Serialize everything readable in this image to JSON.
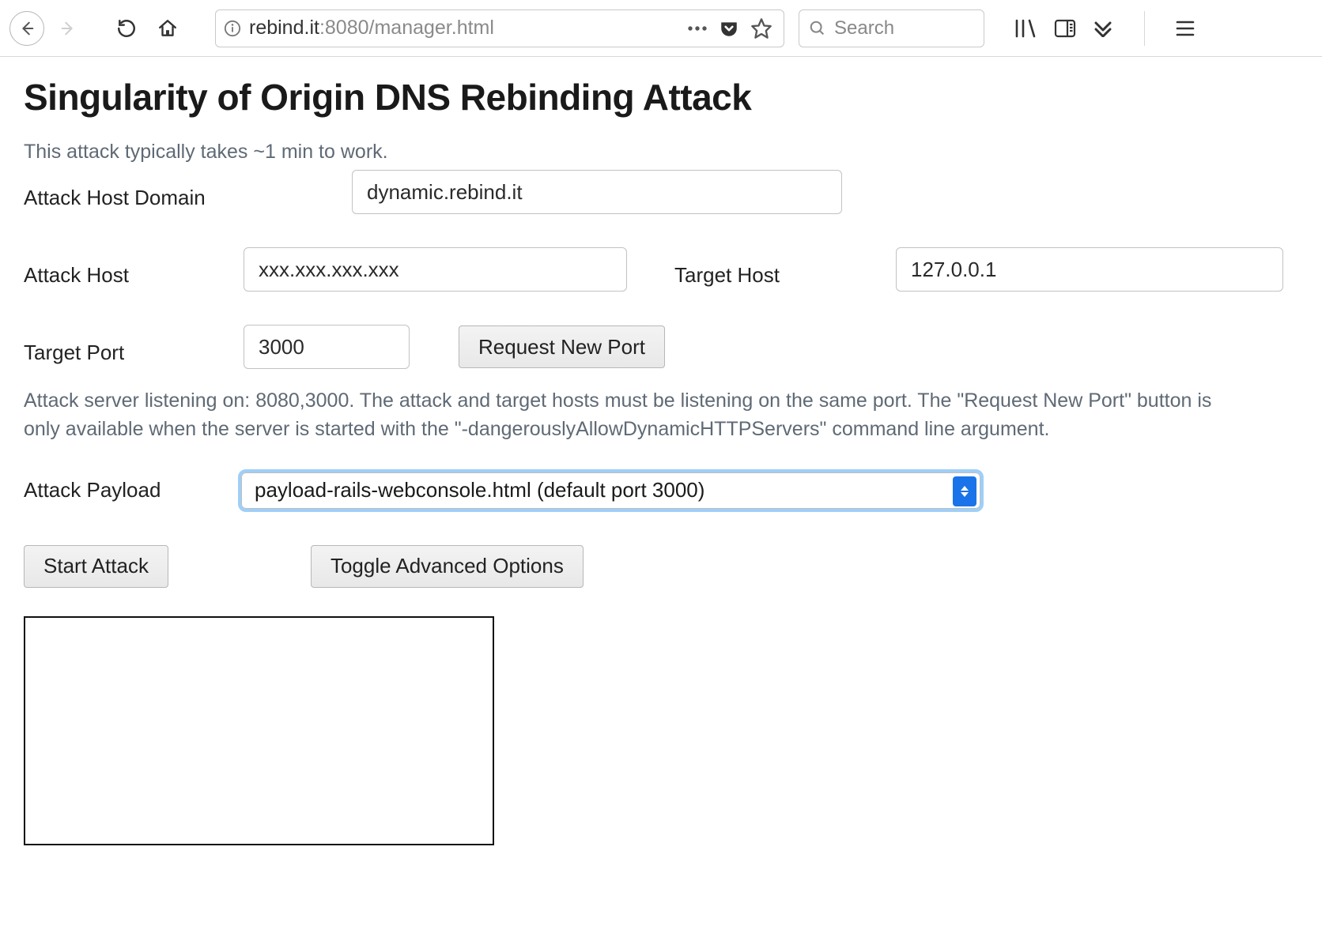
{
  "toolbar": {
    "url_domain": "rebind.it",
    "url_port": ":8080",
    "url_path": "/manager.html",
    "search_placeholder": "Search"
  },
  "page": {
    "title": "Singularity of Origin DNS Rebinding Attack",
    "subtitle": "This attack typically takes ~1 min to work.",
    "labels": {
      "attack_host_domain": "Attack Host Domain",
      "attack_host": "Attack Host",
      "target_host": "Target Host",
      "target_port": "Target Port",
      "attack_payload": "Attack Payload"
    },
    "fields": {
      "attack_host_domain": "dynamic.rebind.it",
      "attack_host": "xxx.xxx.xxx.xxx",
      "target_host": "127.0.0.1",
      "target_port": "3000",
      "attack_payload": "payload-rails-webconsole.html (default port 3000)"
    },
    "buttons": {
      "request_new_port": "Request New Port",
      "start_attack": "Start Attack",
      "toggle_advanced": "Toggle Advanced Options"
    },
    "helptext": "Attack server listening on: 8080,3000. The attack and target hosts must be listening on the same port. The \"Request New Port\" button is only available when the server is started with the \"-dangerouslyAllowDynamicHTTPServers\" command line argument."
  }
}
